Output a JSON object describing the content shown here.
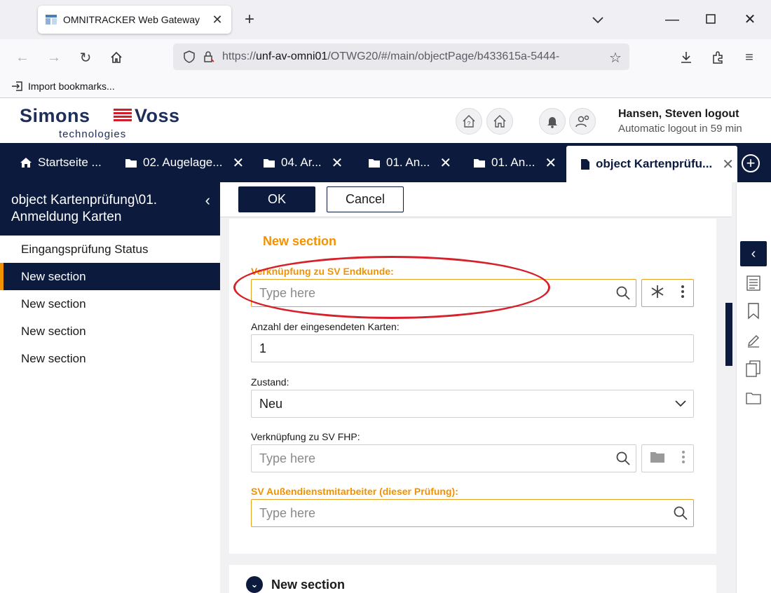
{
  "browser": {
    "tab_title": "OMNITRACKER Web Gateway",
    "url_prefix": "https://",
    "url_host": "unf-av-omni01",
    "url_rest": "/OTWG20/#/main/objectPage/b433615a-5444-",
    "bookmark_label": "Import bookmarks..."
  },
  "header": {
    "logo_simons": "Simons",
    "logo_voss": "Voss",
    "logo_tagline": "technologies",
    "user_name": "Hansen, Steven",
    "logout_label": "logout",
    "auto_logout": "Automatic logout in 59 min"
  },
  "tabs": [
    {
      "label": "Startseite ...",
      "icon": "home-icon"
    },
    {
      "label": "02. Augelage...",
      "icon": "folder-icon"
    },
    {
      "label": "04. Ar...",
      "icon": "folder-icon"
    },
    {
      "label": "01. An...",
      "icon": "folder-icon"
    },
    {
      "label": "01. An...",
      "icon": "folder-icon"
    },
    {
      "label": "object Kartenprüfu...",
      "icon": "document-icon"
    }
  ],
  "left_panel": {
    "title": "object Kartenprüfung\\01. Anmeldung Karten",
    "items": [
      {
        "label": "Eingangsprüfung Status",
        "active": false
      },
      {
        "label": "New section",
        "active": true
      },
      {
        "label": "New section",
        "active": false
      },
      {
        "label": "New section",
        "active": false
      },
      {
        "label": "New section",
        "active": false
      }
    ]
  },
  "toolbar": {
    "ok_label": "OK",
    "cancel_label": "Cancel"
  },
  "form": {
    "section_title": "New section",
    "fields": [
      {
        "label": "Verknüpfung zu SV Endkunde:",
        "placeholder": "Type here",
        "required": true
      },
      {
        "label": "Anzahl der eingesendeten Karten:",
        "value": "1",
        "required": false
      },
      {
        "label": "Zustand:",
        "value": "Neu",
        "required": false
      },
      {
        "label": "Verknüpfung zu SV FHP:",
        "placeholder": "Type here",
        "required": false
      },
      {
        "label": "SV Außendienstmitarbeiter (dieser Prüfung):",
        "placeholder": "Type here",
        "required": true
      }
    ],
    "next_section_title": "New section"
  },
  "colors": {
    "navy": "#0c1b3d",
    "accent_orange": "#f39200",
    "annotation_red": "#d6202a"
  }
}
